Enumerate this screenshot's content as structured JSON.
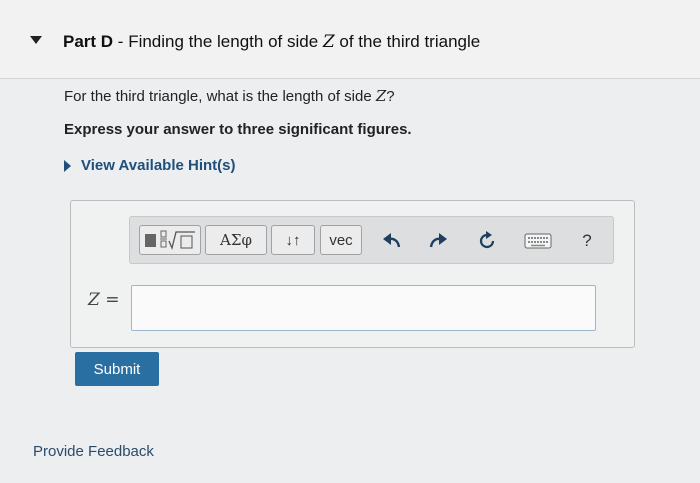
{
  "header": {
    "part_label": "Part D",
    "separator": " - ",
    "title_text": "Finding the length of side ",
    "title_var": "Z",
    "title_suffix": " of the third triangle"
  },
  "question": {
    "text": "For the third triangle, what is the length of side ",
    "var": "Z",
    "suffix": "?"
  },
  "instruction": "Express your answer to three significant figures.",
  "hints": {
    "label": "View Available Hint(s)"
  },
  "toolbar": {
    "templates_icon": "fraction-sqrt-templates-icon",
    "greek_label": "ΑΣφ",
    "arrows_label": "↓↑",
    "vec_label": "vec",
    "undo_icon": "undo-icon",
    "redo_icon": "redo-icon",
    "reset_icon": "reset-icon",
    "keyboard_icon": "keyboard-icon",
    "help_label": "?"
  },
  "answer": {
    "var": "Z",
    "equals": " =",
    "value": ""
  },
  "submit": {
    "label": "Submit"
  },
  "feedback": {
    "label": "Provide Feedback"
  },
  "colors": {
    "submit_bg": "#2a6fa2",
    "link": "#1f4f7a",
    "input_border": "#9ab7cf"
  }
}
